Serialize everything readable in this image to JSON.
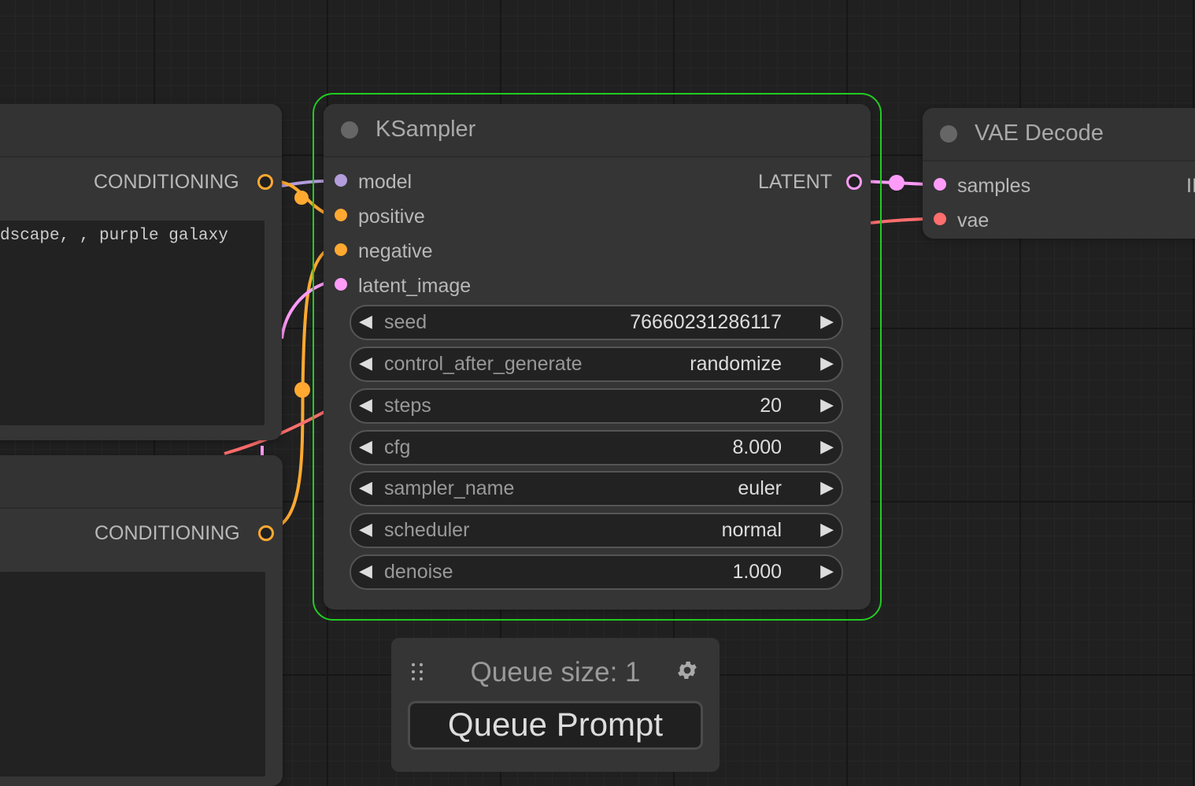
{
  "colors": {
    "model": "#b39ddb",
    "conditioning": "#ffa931",
    "latent": "#ff9cf9",
    "vae": "#ff6e6e",
    "selected_outline": "#22cc22"
  },
  "left_node_top": {
    "output_label": "CONDITIONING",
    "text": "dscape, , purple galaxy"
  },
  "left_node_bottom": {
    "output_label": "CONDITIONING"
  },
  "ksampler": {
    "title": "KSampler",
    "inputs": [
      "model",
      "positive",
      "negative",
      "latent_image"
    ],
    "output": "LATENT",
    "widgets": [
      {
        "name": "seed",
        "value": "76660231286117"
      },
      {
        "name": "control_after_generate",
        "value": "randomize"
      },
      {
        "name": "steps",
        "value": "20"
      },
      {
        "name": "cfg",
        "value": "8.000"
      },
      {
        "name": "sampler_name",
        "value": "euler"
      },
      {
        "name": "scheduler",
        "value": "normal"
      },
      {
        "name": "denoise",
        "value": "1.000"
      }
    ],
    "arrow_left": "◀",
    "arrow_right": "▶"
  },
  "vae_decode": {
    "title": "VAE Decode",
    "inputs": [
      "samples",
      "vae"
    ],
    "output_partial": "II"
  },
  "queue": {
    "size_label": "Queue size: 1",
    "button": "Queue Prompt",
    "drag_icon": "drag-handle-icon",
    "settings_icon": "gear-icon"
  }
}
